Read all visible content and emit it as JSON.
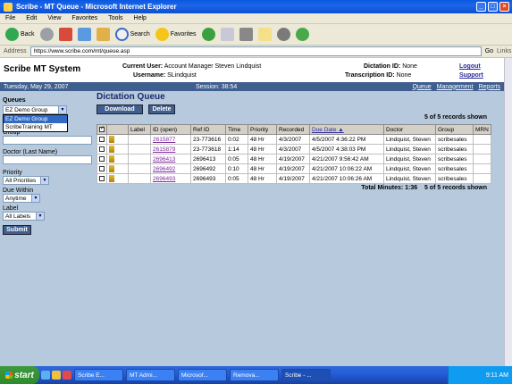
{
  "window": {
    "title": "Scribe - MT Queue - Microsoft Internet Explorer"
  },
  "menu": [
    "File",
    "Edit",
    "View",
    "Favorites",
    "Tools",
    "Help"
  ],
  "toolbar": {
    "back": "Back",
    "search": "Search",
    "favorites": "Favorites"
  },
  "address": {
    "label": "Address",
    "url": "https://www.scribe.com/mt/queue.asp",
    "go": "Go",
    "links": "Links"
  },
  "header": {
    "system_title": "Scribe MT System",
    "current_user_label": "Current User:",
    "current_user": "Account Manager Steven Lindquist",
    "username_label": "Username:",
    "username": "SLindquist",
    "dictation_id_label": "Dictation ID:",
    "dictation_id": "None",
    "transcription_id_label": "Transcription ID:",
    "transcription_id": "None",
    "logout": "Logout",
    "support": "Support"
  },
  "bar": {
    "date": "Tuesday, May 29, 2007",
    "session": "Session: 38:54",
    "nav": [
      "Queue",
      "Management",
      "Reports"
    ]
  },
  "sidebar": {
    "queues_label": "Queues",
    "queue_selected": "EZ Demo Group",
    "queue_options": [
      "EZ Demo Group",
      "ScribeTraining MT"
    ],
    "group_label": "Group",
    "doctor_label": "Doctor (Last Name)",
    "priority_label": "Priority",
    "priority_value": "All Priorities",
    "due_within_label": "Due Within",
    "due_within_value": "Anytime",
    "label_label": "Label",
    "label_value": "All Labels",
    "submit": "Submit"
  },
  "main": {
    "title": "Dictation Queue",
    "download": "Download",
    "delete": "Delete",
    "records_shown": "5 of 5 records shown",
    "total_minutes": "Total Minutes: 1:36",
    "columns": [
      "Label",
      "ID (open)",
      "Ref ID",
      "Time",
      "Priority",
      "Recorded",
      "Due Date",
      "Doctor",
      "Group",
      "MRN"
    ],
    "rows": [
      {
        "id": "2615877",
        "ref": "23-773616",
        "time": "0:02",
        "priority": "48 Hr",
        "recorded": "4/3/2007",
        "due": "4/5/2007 4:36:22 PM",
        "doctor": "Lindquist, Steven",
        "group": "scribesales",
        "mrn": ""
      },
      {
        "id": "2615879",
        "ref": "23-773618",
        "time": "1:14",
        "priority": "48 Hr",
        "recorded": "4/3/2007",
        "due": "4/5/2007 4:38:03 PM",
        "doctor": "Lindquist, Steven",
        "group": "scribesales",
        "mrn": ""
      },
      {
        "id": "2696413",
        "ref": "2696413",
        "time": "0:05",
        "priority": "48 Hr",
        "recorded": "4/19/2007",
        "due": "4/21/2007 9:56:42 AM",
        "doctor": "Lindquist, Steven",
        "group": "scribesales",
        "mrn": ""
      },
      {
        "id": "2696492",
        "ref": "2696492",
        "time": "0:10",
        "priority": "48 Hr",
        "recorded": "4/19/2007",
        "due": "4/21/2007 10:06:22 AM",
        "doctor": "Lindquist, Steven",
        "group": "scribesales",
        "mrn": ""
      },
      {
        "id": "2696493",
        "ref": "2696493",
        "time": "0:05",
        "priority": "48 Hr",
        "recorded": "4/19/2007",
        "due": "4/21/2007 10:06:26 AM",
        "doctor": "Lindquist, Steven",
        "group": "scribesales",
        "mrn": ""
      }
    ]
  },
  "taskbar": {
    "start": "start",
    "tasks": [
      "Scribe E...",
      "MT Admi...",
      "Microsof...",
      "Remova...",
      "Scribe - ..."
    ],
    "clock": "9:11 AM"
  }
}
